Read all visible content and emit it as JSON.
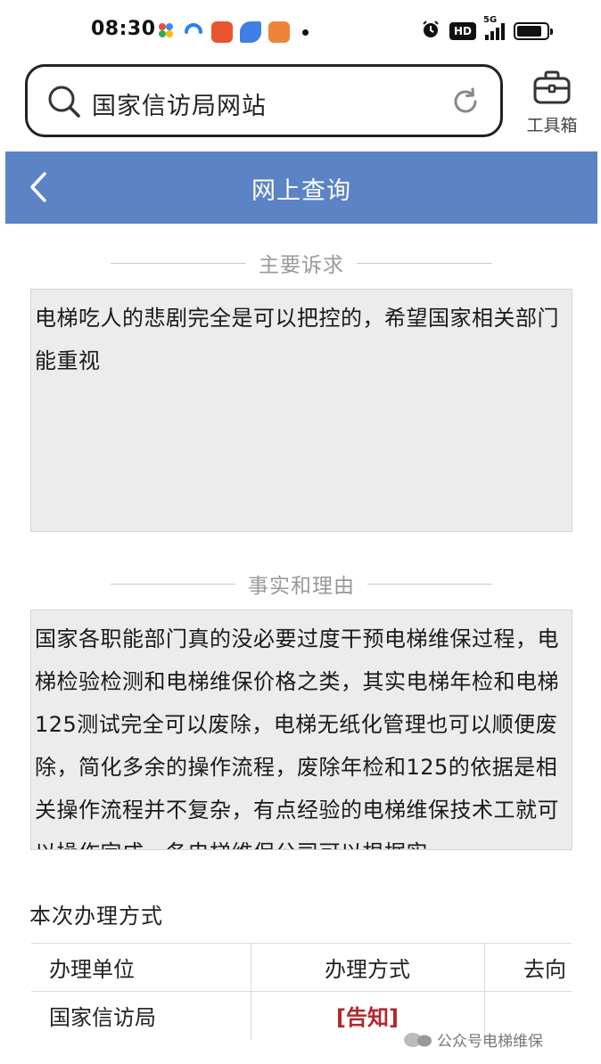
{
  "status_bar": {
    "time": "08:30",
    "network_label": "5G"
  },
  "search": {
    "query": "国家信访局网站"
  },
  "toolbox": {
    "label": "工具箱"
  },
  "header": {
    "title": "网上查询"
  },
  "main_appeal": {
    "heading": "主要诉求",
    "content": "电梯吃人的悲剧完全是可以把控的，希望国家相关部门能重视"
  },
  "facts_reasons": {
    "heading": "事实和理由",
    "content": "国家各职能部门真的没必要过度干预电梯维保过程，电梯检验检测和电梯维保价格之类，其实电梯年检和电梯125测试完全可以废除，电梯无纸化管理也可以顺便废除，简化多余的操作流程，废除年检和125的依据是相关操作流程并不复杂，有点经验的电梯维保技术工就可以操作完成，各电梯维保公司可以根据实"
  },
  "handling": {
    "title": "本次办理方式",
    "columns": [
      "办理单位",
      "办理方式",
      "去向"
    ],
    "rows": [
      {
        "unit": "国家信访局",
        "method": "[告知]",
        "direction": ""
      }
    ]
  },
  "watermark": {
    "text": "公众号电梯维保"
  },
  "colors": {
    "header_bg": "#5b83c6",
    "notice_red": "#b3262a",
    "text_box_bg": "#ececec"
  }
}
